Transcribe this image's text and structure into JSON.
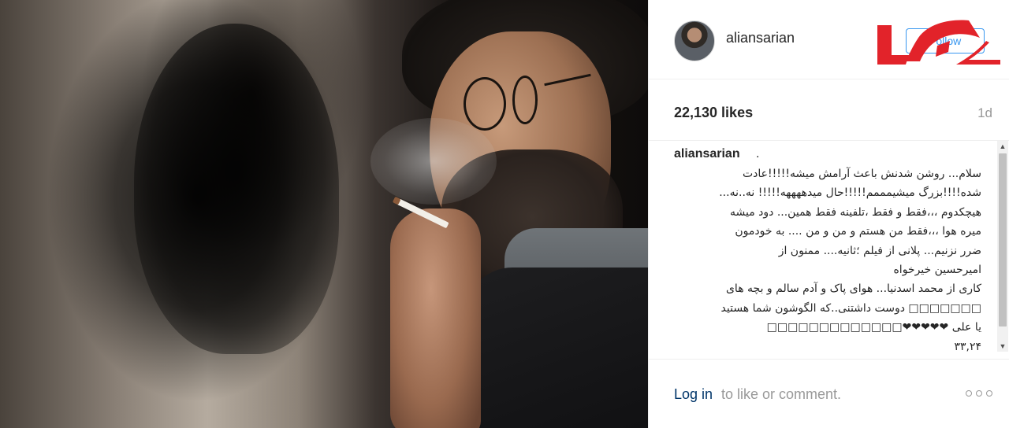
{
  "post": {
    "username": "aliansarian",
    "follow_label": "Follow",
    "likes": "22,130 likes",
    "time_ago": "1d",
    "caption_user": "aliansarian",
    "caption_dot": ".",
    "caption_lines": [
      "سلام... روشن شدنش باعث آرامش میشه!!!!!عادت",
      "شده!!!!بزرگ میشیمممم!!!!!حال میدههههه!!!!! نه..نه...",
      "هیچکدوم ،،،فقط و فقط ،تلفینه فقط همین... دود میشه",
      "میره هوا ،،،فقط من هستم و من و من .... به خودمون",
      "ضرر نزنیم... پلانی از فیلم ؛ثانیه.... ممنون از",
      "امیرحسین خیرخواه",
      "کاری از محمد اسدنیا... هوای پاک و آدم سالم و بچه های",
      "□□□□□□□ دوست داشتنی..که الگوشون شما هستید",
      "یا علی ❤❤❤❤❤□□□□□□□□□□□□□",
      "۳۳,۲۴"
    ],
    "login_link": "Log in",
    "login_rest": "to like or comment."
  },
  "icons": {
    "more": "more-options-icon",
    "scroll_up": "▲",
    "scroll_down": "▼"
  },
  "colors": {
    "link_blue": "#003569",
    "follow_blue": "#3897f0",
    "logo_red": "#e2232a",
    "muted_gray": "#999999",
    "border": "#efefef"
  }
}
